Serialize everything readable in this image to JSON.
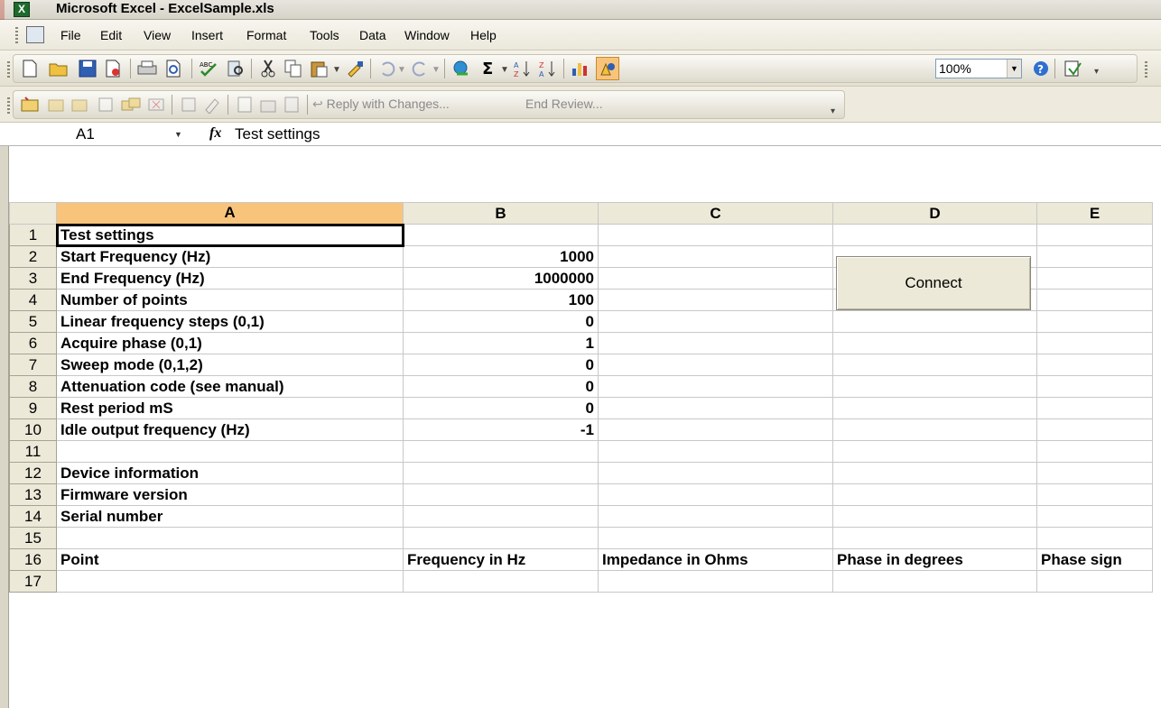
{
  "window": {
    "title": "Microsoft Excel - ExcelSample.xls",
    "app_icon": "excel-icon"
  },
  "menu": {
    "items": [
      "File",
      "Edit",
      "View",
      "Insert",
      "Format",
      "Tools",
      "Data",
      "Window",
      "Help"
    ]
  },
  "toolbar": {
    "zoom": "100%"
  },
  "reviewing": {
    "reply_label": "Reply with Changes...",
    "end_label": "End Review..."
  },
  "formula_bar": {
    "name_box": "A1",
    "fx": "fx",
    "formula": "Test settings"
  },
  "grid": {
    "columns": [
      "A",
      "B",
      "C",
      "D",
      "E"
    ],
    "selected_column": "A",
    "active_cell": "A1",
    "rows": [
      {
        "n": "1",
        "a": "Test settings",
        "b": "",
        "c": "",
        "d": "",
        "e": ""
      },
      {
        "n": "2",
        "a": "Start Frequency (Hz)",
        "b": "1000",
        "c": "",
        "d": "",
        "e": ""
      },
      {
        "n": "3",
        "a": "End Frequency (Hz)",
        "b": "1000000",
        "c": "",
        "d": "",
        "e": ""
      },
      {
        "n": "4",
        "a": "Number of points",
        "b": "100",
        "c": "",
        "d": "",
        "e": ""
      },
      {
        "n": "5",
        "a": "Linear frequency steps (0,1)",
        "b": "0",
        "c": "",
        "d": "",
        "e": ""
      },
      {
        "n": "6",
        "a": "Acquire phase (0,1)",
        "b": "1",
        "c": "",
        "d": "",
        "e": ""
      },
      {
        "n": "7",
        "a": "Sweep mode (0,1,2)",
        "b": "0",
        "c": "",
        "d": "",
        "e": ""
      },
      {
        "n": "8",
        "a": "Attenuation code (see manual)",
        "b": "0",
        "c": "",
        "d": "",
        "e": ""
      },
      {
        "n": "9",
        "a": "Rest period mS",
        "b": "0",
        "c": "",
        "d": "",
        "e": ""
      },
      {
        "n": "10",
        "a": "Idle output frequency (Hz)",
        "b": "-1",
        "c": "",
        "d": "",
        "e": ""
      },
      {
        "n": "11",
        "a": "",
        "b": "",
        "c": "",
        "d": "",
        "e": ""
      },
      {
        "n": "12",
        "a": "Device information",
        "b": "",
        "c": "",
        "d": "",
        "e": ""
      },
      {
        "n": "13",
        "a": "Firmware version",
        "b": "",
        "c": "",
        "d": "",
        "e": ""
      },
      {
        "n": "14",
        "a": "Serial number",
        "b": "",
        "c": "",
        "d": "",
        "e": ""
      },
      {
        "n": "15",
        "a": "",
        "b": "",
        "c": "",
        "d": "",
        "e": ""
      },
      {
        "n": "16",
        "a": "Point",
        "b": "Frequency in Hz",
        "c": "Impedance in Ohms",
        "d": "Phase in degrees",
        "e": "Phase sign"
      },
      {
        "n": "17",
        "a": "",
        "b": "",
        "c": "",
        "d": "",
        "e": ""
      }
    ]
  },
  "buttons": {
    "connect": "Connect"
  }
}
